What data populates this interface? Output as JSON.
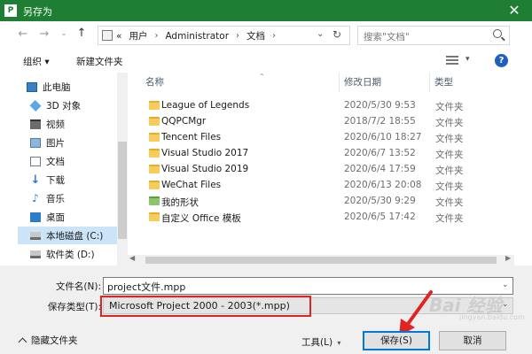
{
  "window": {
    "title": "另存为",
    "app_badge": "P"
  },
  "address": {
    "overflow": "«",
    "crumbs": [
      "用户",
      "Administrator",
      "文档"
    ],
    "search_placeholder": "搜索\"文档\""
  },
  "toolbar": {
    "organize": "组织 ▾",
    "new_folder": "新建文件夹"
  },
  "nav": {
    "items": [
      {
        "label": "此电脑",
        "icon": "computer-icon"
      },
      {
        "label": "3D 对象",
        "icon": "cube-icon"
      },
      {
        "label": "视频",
        "icon": "video-icon"
      },
      {
        "label": "图片",
        "icon": "picture-icon"
      },
      {
        "label": "文档",
        "icon": "document-icon"
      },
      {
        "label": "下载",
        "icon": "download-icon"
      },
      {
        "label": "音乐",
        "icon": "music-icon"
      },
      {
        "label": "桌面",
        "icon": "desktop-icon"
      },
      {
        "label": "本地磁盘 (C:)",
        "icon": "drive-icon"
      },
      {
        "label": "软件类 (D:)",
        "icon": "drive-icon"
      }
    ],
    "selected_index": 8
  },
  "columns": {
    "name": "名称",
    "date": "修改日期",
    "type": "类型"
  },
  "files": [
    {
      "name": "League of Legends",
      "date": "2020/5/30 9:53",
      "type": "文件夹"
    },
    {
      "name": "QQPCMgr",
      "date": "2018/7/2 18:55",
      "type": "文件夹"
    },
    {
      "name": "Tencent Files",
      "date": "2020/6/10 18:27",
      "type": "文件夹"
    },
    {
      "name": "Visual Studio 2017",
      "date": "2020/6/7 13:52",
      "type": "文件夹"
    },
    {
      "name": "Visual Studio 2019",
      "date": "2020/6/4 17:59",
      "type": "文件夹"
    },
    {
      "name": "WeChat Files",
      "date": "2020/6/13 20:08",
      "type": "文件夹"
    },
    {
      "name": "我的形状",
      "date": "2020/5/30 9:29",
      "type": "文件夹"
    },
    {
      "name": "自定义 Office 模板",
      "date": "2020/6/5 17:42",
      "type": "文件夹"
    }
  ],
  "form": {
    "filename_label": "文件名(N):",
    "filename_value": "project文件.mpp",
    "filetype_label": "保存类型(T):",
    "filetype_value": "Microsoft Project 2000 - 2003(*.mpp)"
  },
  "footer": {
    "hide_folders": "隐藏文件夹",
    "tools": "工具(L)",
    "save": "保存(S)",
    "cancel": "取消"
  },
  "watermark": {
    "text": "Bai  经验",
    "sub": "jingyan.baidu.com"
  },
  "colors": {
    "titlebar": "#1e7e34",
    "selection": "#cce4f7",
    "highlight": "#e02424",
    "accent": "#0078d7"
  }
}
